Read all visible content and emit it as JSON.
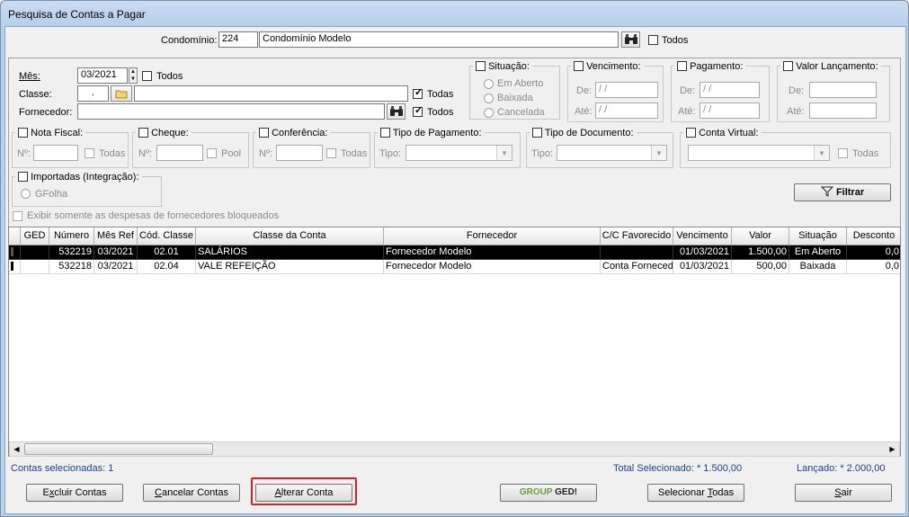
{
  "window": {
    "title": "Pesquisa de Contas a Pagar"
  },
  "top": {
    "condominio_label": "Condomínio:",
    "condominio_code": "224",
    "condominio_name": "Condomínio Modelo",
    "todos_label": "Todos"
  },
  "filters": {
    "mes_label": "Mês:",
    "mes_value": "03/2021",
    "mes_todos": "Todos",
    "classe_label": "Classe:",
    "classe_code": ".",
    "classe_todas": "Todas",
    "fornecedor_label": "Fornecedor:",
    "fornecedor_todos": "Todos",
    "situacao": {
      "title": "Situação:",
      "options": [
        "Em Aberto",
        "Baixada",
        "Cancelada"
      ]
    },
    "vencimento": {
      "title": "Vencimento:",
      "de": "De:",
      "ate": "Até:",
      "de_value": " / /",
      "ate_value": " / /"
    },
    "pagamento": {
      "title": "Pagamento:",
      "de": "De:",
      "ate": "Até:",
      "de_value": " / /",
      "ate_value": " / /"
    },
    "valor_lancamento": {
      "title": "Valor Lançamento:",
      "de": "De:",
      "ate": "Até:"
    },
    "nota_fiscal": {
      "title": "Nota Fiscal:",
      "no": "Nº:",
      "todas": "Todas"
    },
    "cheque": {
      "title": "Cheque:",
      "no": "Nº:",
      "pool": "Pool"
    },
    "conferencia": {
      "title": "Conferência:",
      "no": "Nº:",
      "todas": "Todas"
    },
    "tipo_pagamento": {
      "title": "Tipo de Pagamento:",
      "tipo": "Tipo:"
    },
    "tipo_documento": {
      "title": "Tipo de Documento:",
      "tipo": "Tipo:"
    },
    "conta_virtual": {
      "title": "Conta Virtual:",
      "todas": "Todas"
    },
    "importadas": {
      "title": "Importadas (Integração):",
      "gfolha": "GFolha"
    },
    "bloqueados_label": "Exibir somente as despesas de fornecedores bloqueados",
    "filtrar_label": "Filtrar"
  },
  "table": {
    "columns": [
      "GED",
      "Número",
      "Mês Ref",
      "Cód. Classe",
      "Classe da Conta",
      "Fornecedor",
      "C/C Favorecido",
      "Vencimento",
      "Valor",
      "Situação",
      "Desconto"
    ],
    "rows": [
      {
        "ged": "",
        "numero": "532219",
        "mes_ref": "03/2021",
        "cod_classe": "02.01",
        "classe": "SALÁRIOS",
        "fornecedor": "Fornecedor Modelo",
        "cc_favorecido": "",
        "vencimento": "01/03/2021",
        "valor": "1.500,00",
        "situacao": "Em Aberto",
        "desconto": "0,0"
      },
      {
        "ged": "",
        "numero": "532218",
        "mes_ref": "03/2021",
        "cod_classe": "02.04",
        "classe": "VALE REFEIÇÃO",
        "fornecedor": "Fornecedor Modelo",
        "cc_favorecido": "Conta Forneced",
        "vencimento": "01/03/2021",
        "valor": "500,00",
        "situacao": "Baixada",
        "desconto": "0,0"
      }
    ]
  },
  "status": {
    "contas_selecionadas": "Contas selecionadas: 1",
    "total_selecionado": "Total Selecionado: * 1.500,00",
    "lancado": "Lançado: * 2.000,00"
  },
  "buttons": {
    "excluir_pre": "E",
    "excluir_u": "x",
    "excluir_post": "cluir Contas",
    "cancelar_u": "C",
    "cancelar_post": "ancelar Contas",
    "alterar_u": "A",
    "alterar_post": "lterar Conta",
    "ged_logo_a": "GROUP",
    "ged_logo_b": "GED!",
    "selecionar_pre": "Selecionar ",
    "selecionar_u": "T",
    "selecionar_post": "odas",
    "sair_u": "S",
    "sair_post": "air"
  },
  "colors": {
    "highlight": "#d81f26",
    "status_text": "#1f3f8f",
    "selected_row": "#000000"
  }
}
